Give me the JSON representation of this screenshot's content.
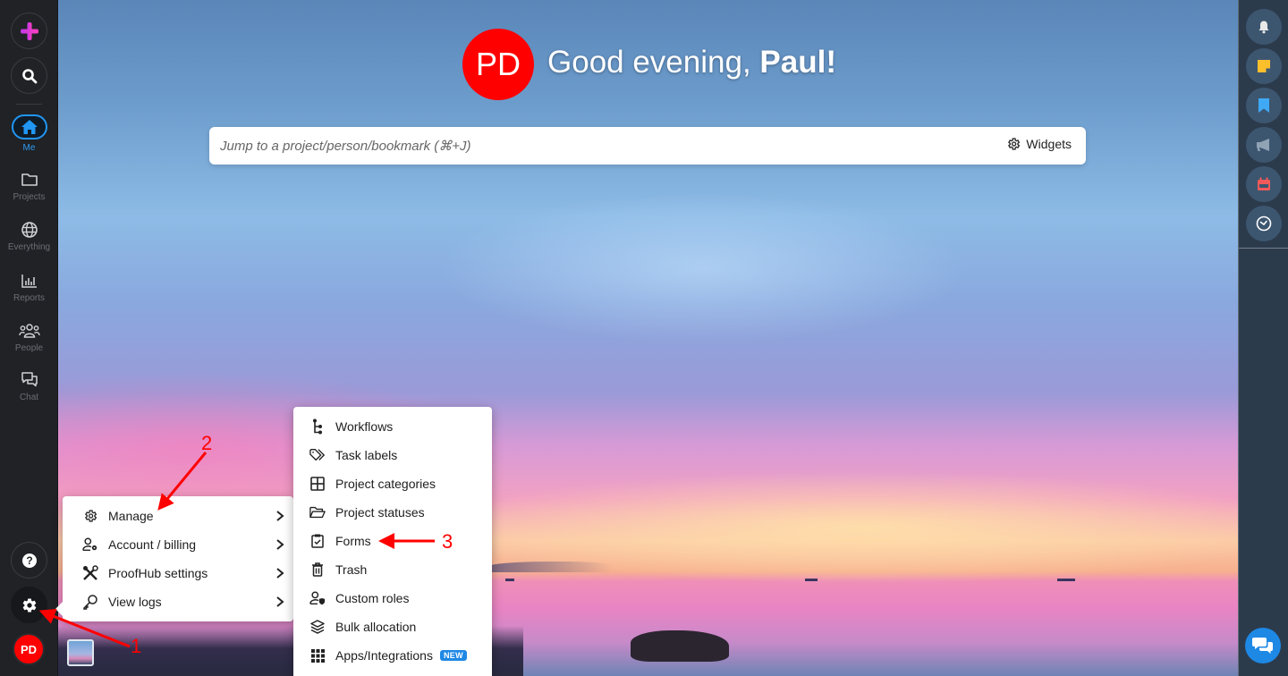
{
  "app": "ProofHub",
  "sidebar": {
    "add_button": "add",
    "search_button": "search",
    "items": [
      {
        "label": "Me",
        "icon": "home-icon",
        "active": true
      },
      {
        "label": "Projects",
        "icon": "folder-icon",
        "active": false
      },
      {
        "label": "Everything",
        "icon": "globe-icon",
        "active": false
      },
      {
        "label": "Reports",
        "icon": "bar-chart-icon",
        "active": false
      },
      {
        "label": "People",
        "icon": "people-icon",
        "active": false
      },
      {
        "label": "Chat",
        "icon": "chat-icon",
        "active": false
      }
    ],
    "help_icon": "question-circle-icon",
    "settings_icon": "gear-icon",
    "user_initials": "PD"
  },
  "header": {
    "avatar_initials": "PD",
    "greeting_prefix": "Good evening, ",
    "greeting_name": "Paul!"
  },
  "jump_bar": {
    "placeholder": "Jump to a project/person/bookmark (⌘+J)",
    "value": "",
    "widgets_label": "Widgets"
  },
  "right_rail": {
    "buttons": [
      {
        "name": "notifications",
        "icon": "bell-icon",
        "color": "#e8e8e8"
      },
      {
        "name": "notes",
        "icon": "sticky-note-icon",
        "color": "#fbbf2c"
      },
      {
        "name": "bookmarks",
        "icon": "bookmark-icon",
        "color": "#3fa9f5"
      },
      {
        "name": "announcements",
        "icon": "megaphone-icon",
        "color": "#8fa3b5"
      },
      {
        "name": "calendar",
        "icon": "calendar-icon",
        "color": "#f25a5a"
      },
      {
        "name": "timesheets",
        "icon": "clock-icon",
        "color": "#ffffff"
      }
    ],
    "chat_fab_icon": "chat-bubbles-icon"
  },
  "settings_menu": {
    "items": [
      {
        "label": "Manage",
        "icon": "gear-outline-icon",
        "has_submenu": true
      },
      {
        "label": "Account / billing",
        "icon": "user-gear-icon",
        "has_submenu": true
      },
      {
        "label": "ProofHub settings",
        "icon": "tools-icon",
        "has_submenu": true
      },
      {
        "label": "View logs",
        "icon": "key-icon",
        "has_submenu": true
      }
    ]
  },
  "manage_submenu": {
    "items": [
      {
        "label": "Workflows",
        "icon": "workflow-icon"
      },
      {
        "label": "Task labels",
        "icon": "tag-icon"
      },
      {
        "label": "Project categories",
        "icon": "grid-icon"
      },
      {
        "label": "Project statuses",
        "icon": "folder-open-icon"
      },
      {
        "label": "Forms",
        "icon": "clipboard-check-icon"
      },
      {
        "label": "Trash",
        "icon": "trash-icon"
      },
      {
        "label": "Custom roles",
        "icon": "user-shield-icon"
      },
      {
        "label": "Bulk allocation",
        "icon": "layers-icon"
      },
      {
        "label": "Apps/Integrations",
        "icon": "apps-grid-icon",
        "badge": "NEW"
      }
    ]
  },
  "annotations": [
    {
      "label": "1",
      "target": "settings-gear"
    },
    {
      "label": "2",
      "target": "Manage"
    },
    {
      "label": "3",
      "target": "Forms"
    }
  ],
  "colors": {
    "accent": "#2196f3",
    "avatar": "#ff0000",
    "annotation": "#ff0000",
    "new_badge": "#1e88e5"
  }
}
